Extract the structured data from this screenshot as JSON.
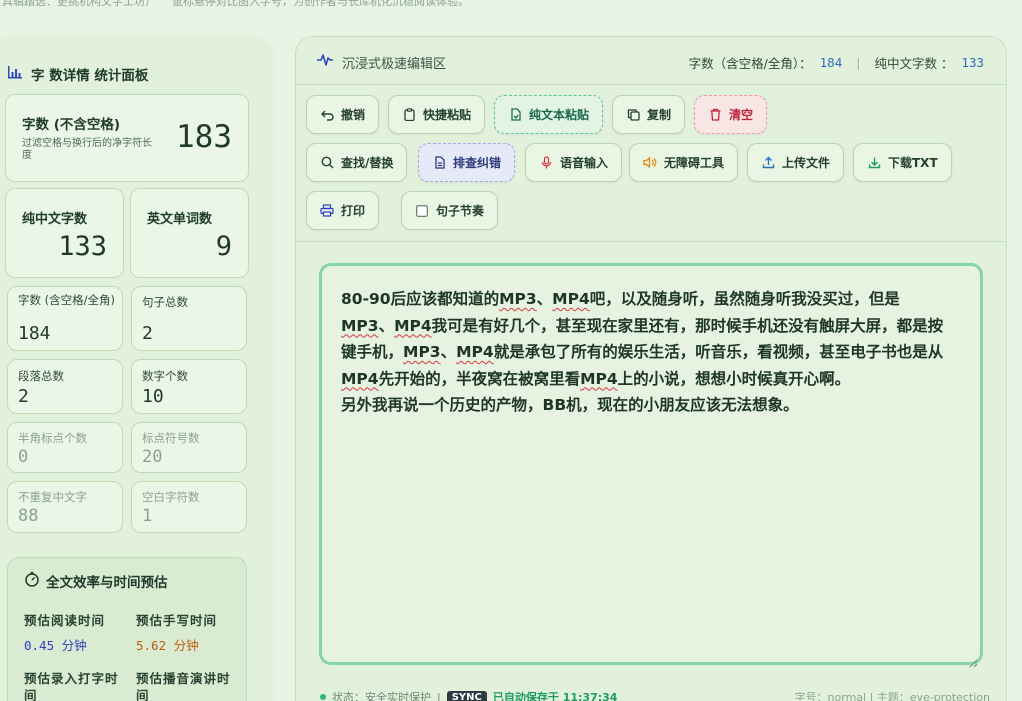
{
  "top": {
    "left_text": "具辑踏选：更挑机构文字工坊）",
    "right_text": "鼠标悬停对比图入字号，为创作者与长库机化沉稳阅读体验。"
  },
  "stats_panel": {
    "title": "字 数详情 统计面板",
    "main": {
      "label": "字数 (不含空格)",
      "desc": "过滤空格与换行后的净字符长度",
      "value": "183"
    },
    "pair": [
      {
        "label": "纯中文字数",
        "value": "133"
      },
      {
        "label": "英文单词数",
        "value": "9"
      }
    ],
    "grid": [
      {
        "label": "字数 (含空格/全角)",
        "value": "184"
      },
      {
        "label": "句子总数",
        "value": "2"
      },
      {
        "label": "段落总数",
        "value": "2"
      },
      {
        "label": "数字个数",
        "value": "10"
      },
      {
        "label": "半角标点个数",
        "value": "0"
      },
      {
        "label": "标点符号数",
        "value": "20"
      },
      {
        "label": "不重复中文字",
        "value": "88"
      },
      {
        "label": "空白字符数",
        "value": "1"
      }
    ],
    "efficiency": {
      "title": "全文效率与时间预估",
      "read_label": "预估阅读时间",
      "read_value": "0.45 分钟",
      "write_label": "预估手写时间",
      "write_value": "5.62 分钟",
      "type_label": "预估录入打字时间",
      "speech_label": "预估播音演讲时间"
    }
  },
  "editor_panel": {
    "title": "沉浸式极速编辑区",
    "chars_label": "字数（含空格/全角）：",
    "chars_value": "184",
    "cn_label": "纯中文字数 ：",
    "cn_value": "133",
    "buttons": {
      "undo": "撤销",
      "quick_paste": "快捷粘贴",
      "plain_paste": "纯文本粘贴",
      "copy": "复制",
      "clear": "清空",
      "find_replace": "查找/替换",
      "proofread": "排查纠错",
      "voice": "语音输入",
      "accessibility": "无障碍工具",
      "upload": "上传文件",
      "download": "下载TXT",
      "print": "打印",
      "rhythm": "句子节奏"
    },
    "text_lines": [
      "80-90后应该都知道的MP3、MP4吧，以及随身听，虽然随身听我没买过，但是",
      "MP3、MP4我可是有好几个，甚至现在家里还有，那时候手机还没有触屏大屏，都是按",
      "键手机，MP3、MP4就是承包了所有的娱乐生活，听音乐，看视频，甚至电子书也是从",
      "MP4先开始的，半夜窝在被窝里看MP4上的小说，想想小时候真开心啊。",
      "另外我再说一个历史的产物，BB机，现在的小朋友应该无法想象。"
    ],
    "status": {
      "state": "状态：安全实时保护",
      "sync": "SYNC",
      "saved": "已自动保存于 11:37:34",
      "right": "字号：normal  |  主题：eye-protection"
    }
  },
  "colors": {
    "accent": "#2fb67a",
    "danger": "#c0243b",
    "link": "#2f6fc1"
  }
}
